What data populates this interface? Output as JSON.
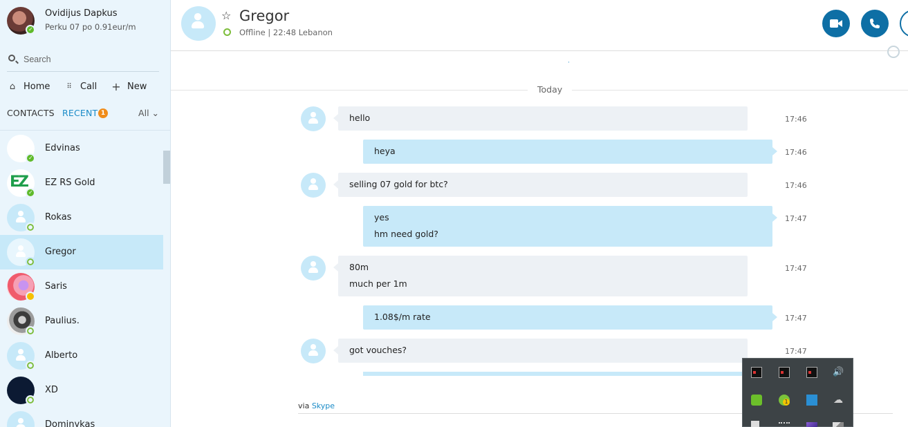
{
  "profile": {
    "name": "Ovidijus Dapkus",
    "mood": "Perku 07 po 0.91eur/m"
  },
  "search": {
    "placeholder": "Search"
  },
  "nav": {
    "home": "Home",
    "call": "Call",
    "new": "New"
  },
  "tabs": {
    "contacts": "CONTACTS",
    "recent": "RECENT",
    "recent_badge": "1",
    "filter": "All ⌄"
  },
  "contacts": [
    {
      "name": "Edvinas",
      "status": "online"
    },
    {
      "name": "EZ RS Gold",
      "status": "online",
      "avatar_text": "EZ"
    },
    {
      "name": "Rokas",
      "status": "offline"
    },
    {
      "name": "Gregor",
      "status": "offline",
      "active": true
    },
    {
      "name": "Saris",
      "status": "away"
    },
    {
      "name": "Paulius.",
      "status": "offline"
    },
    {
      "name": "Alberto",
      "status": "offline"
    },
    {
      "name": "XD",
      "status": "offline"
    },
    {
      "name": "Dominykas",
      "status": "offline"
    }
  ],
  "chat": {
    "name": "Gregor",
    "status_text": "Offline | 22:48 Lebanon",
    "divider": "Today",
    "messages": [
      {
        "dir": "in",
        "lines": [
          "hello"
        ],
        "time": "17:46"
      },
      {
        "dir": "out",
        "lines": [
          "heya"
        ],
        "time": "17:46"
      },
      {
        "dir": "in",
        "lines": [
          "selling 07 gold for btc?"
        ],
        "time": "17:46"
      },
      {
        "dir": "out",
        "lines": [
          "yes",
          "hm need gold?"
        ],
        "time": "17:47"
      },
      {
        "dir": "in",
        "lines": [
          "80m",
          "much per 1m"
        ],
        "time": "17:47"
      },
      {
        "dir": "out",
        "lines": [
          "1.08$/m rate"
        ],
        "time": "17:47"
      },
      {
        "dir": "in",
        "lines": [
          "got vouches?"
        ],
        "time": "17:47"
      }
    ],
    "via_prefix": "via",
    "via_link": "Skype"
  },
  "icons": {
    "video": "video-camera-icon",
    "call": "phone-icon",
    "add": "add-person-icon",
    "globe": "globe-icon"
  },
  "colors": {
    "accent": "#0e6fa5",
    "sidebar_bg": "#eaf5fc",
    "out_bubble": "#c7e9f9",
    "in_bubble": "#edf1f5",
    "online": "#5fba2a",
    "badge": "#f08c1a"
  }
}
